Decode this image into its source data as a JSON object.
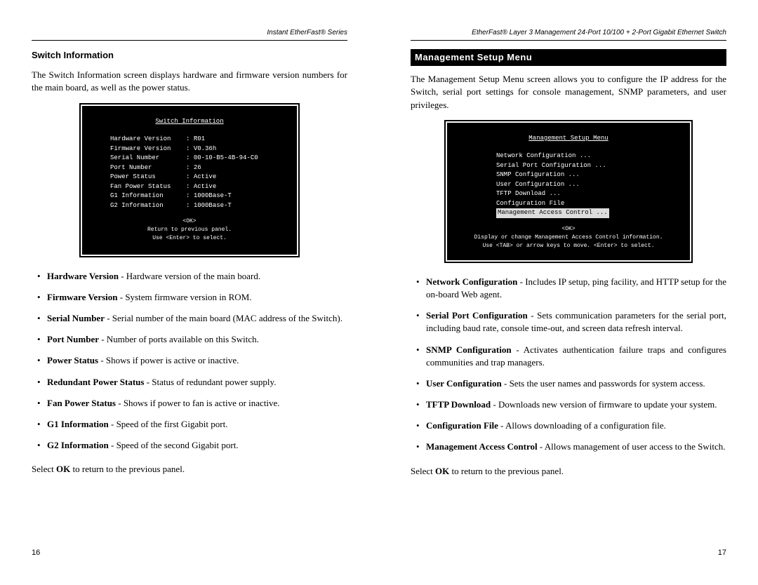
{
  "left": {
    "header": "Instant EtherFast® Series",
    "section_title": "Switch Information",
    "intro": "The Switch Information screen displays hardware and firmware version numbers for the main board, as well as the power status.",
    "screenshot": {
      "title": "Switch Information",
      "rows": [
        [
          "Hardware Version",
          ": R01"
        ],
        [
          "Firmware Version",
          ": V0.36h"
        ],
        [
          "Serial Number",
          ": 00-10-B5-4B-94-C0"
        ],
        [
          "Port Number",
          ": 26"
        ],
        [
          "Power Status",
          ": Active"
        ],
        [
          "Fan Power Status",
          ": Active"
        ],
        [
          "G1 Information",
          ": 1000Base-T"
        ],
        [
          "G2 Information",
          ": 1000Base-T"
        ]
      ],
      "footer1": "<OK>",
      "footer2": "Return to previous panel.",
      "footer3": "Use <Enter> to select."
    },
    "bullets": [
      {
        "term": "Hardware Version",
        "desc": " - Hardware version of the main board."
      },
      {
        "term": "Firmware Version",
        "desc": " - System firmware version in ROM."
      },
      {
        "term": "Serial Number",
        "desc": " - Serial number of the main board (MAC address of the Switch)."
      },
      {
        "term": "Port Number",
        "desc": " - Number of ports available on this Switch."
      },
      {
        "term": "Power Status",
        "desc": " - Shows if power is active or inactive."
      },
      {
        "term": "Redundant Power Status",
        "desc": " - Status of redundant power supply."
      },
      {
        "term": "Fan Power Status",
        "desc": " - Shows if power to fan is active or inactive."
      },
      {
        "term": "G1 Information",
        "desc": " - Speed of the first Gigabit port."
      },
      {
        "term": "G2 Information",
        "desc": " - Speed of the second Gigabit port."
      }
    ],
    "closing_pre": "Select ",
    "closing_bold": "OK",
    "closing_post": " to return to the previous panel.",
    "page_num": "16"
  },
  "right": {
    "header": "EtherFast® Layer 3 Management 24-Port 10/100 + 2-Port Gigabit Ethernet Switch",
    "section_title": "Management Setup Menu",
    "intro": "The Management Setup Menu screen allows you to configure the IP address for the Switch, serial port settings for console management, SNMP parameters, and user privileges.",
    "screenshot": {
      "title": "Management Setup Menu",
      "items": [
        "Network Configuration ...",
        "Serial Port Configuration ...",
        "SNMP Configuration ...",
        "User Configuration ...",
        "TFTP Download ...",
        "Configuration File"
      ],
      "highlight": "Management Access Control ...",
      "footer1": "<OK>",
      "footer2": "Display or change Management Access Control information.",
      "footer3": "Use <TAB> or arrow keys to move. <Enter> to select."
    },
    "bullets": [
      {
        "term": "Network Configuration",
        "desc": " - Includes IP setup, ping facility, and HTTP setup for the on-board Web agent."
      },
      {
        "term": "Serial Port Configuration",
        "desc": " - Sets communication parameters for the serial port, including baud rate, console time-out, and screen data refresh interval."
      },
      {
        "term": "SNMP Configuration",
        "desc": " - Activates authentication failure traps and configures communities and trap managers."
      },
      {
        "term": "User Configuration",
        "desc": " - Sets the user names and passwords for system access."
      },
      {
        "term": "TFTP Download",
        "desc": " - Downloads new version of firmware to update your system."
      },
      {
        "term": "Configuration File",
        "desc": " - Allows downloading of a configuration file."
      },
      {
        "term": "Management Access Control",
        "desc": " - Allows management of user access to the Switch."
      }
    ],
    "closing_pre": "Select ",
    "closing_bold": "OK",
    "closing_post": " to return to the previous panel.",
    "page_num": "17"
  }
}
